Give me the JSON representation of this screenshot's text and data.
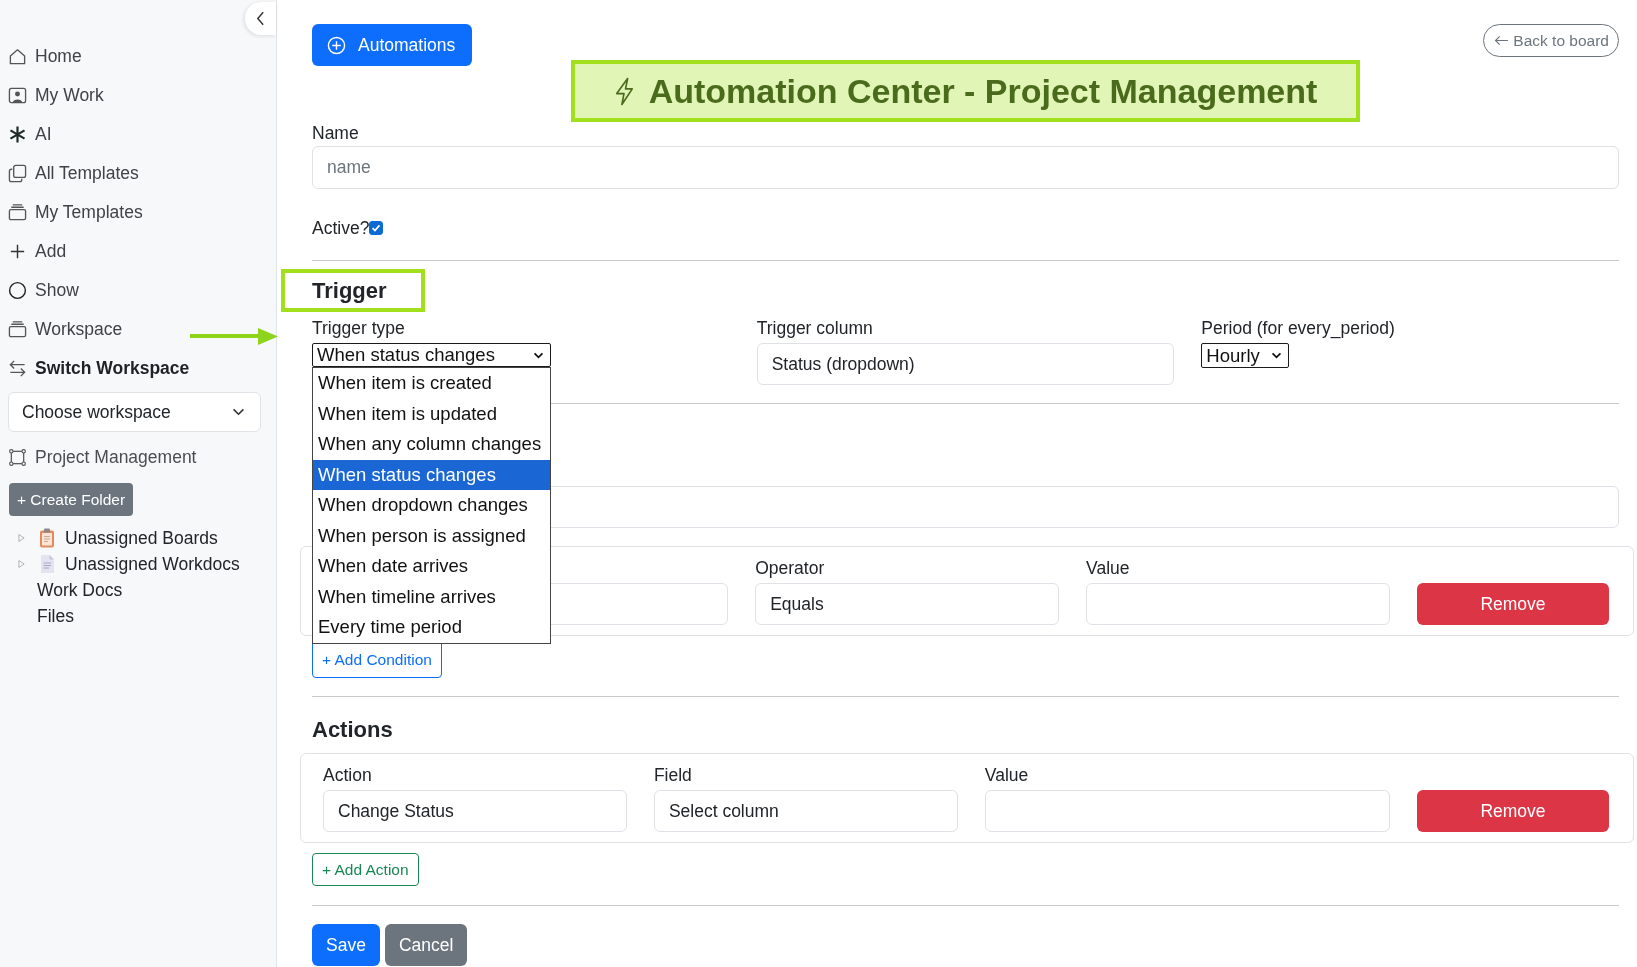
{
  "sidebar": {
    "items": [
      {
        "label": "Home",
        "kind": "link"
      },
      {
        "label": "My Work",
        "kind": "link"
      },
      {
        "label": "AI",
        "kind": "link"
      },
      {
        "label": "All Templates",
        "kind": "link"
      },
      {
        "label": "My Templates",
        "kind": "link"
      },
      {
        "label": "Add",
        "kind": "link"
      },
      {
        "label": "Show",
        "kind": "link"
      },
      {
        "label": "Workspace",
        "kind": "link"
      },
      {
        "label": "Switch Workspace",
        "kind": "heading"
      }
    ],
    "workspace_select": {
      "value": "Choose workspace"
    },
    "workspace": {
      "label": "Project Management"
    },
    "create_folder_button": "+ Create Folder",
    "tree": [
      {
        "label": "Unassigned Boards",
        "kind": "boards",
        "expanded": false
      },
      {
        "label": "Unassigned Workdocs",
        "kind": "docs",
        "expanded": false
      },
      {
        "label": "Work Docs",
        "kind": "link"
      },
      {
        "label": "Files",
        "kind": "link"
      }
    ]
  },
  "header": {
    "automations_button": "Automations",
    "title": "Automation Center - Project Management",
    "back_button": "Back to board"
  },
  "name_field": {
    "label": "Name",
    "placeholder": "name"
  },
  "active": {
    "label": "Active?",
    "checked": true
  },
  "trigger": {
    "heading": "Trigger",
    "type_select": {
      "label": "Trigger type",
      "value": "When status changes",
      "open": true,
      "options": [
        {
          "label": "When item is created",
          "selected": false
        },
        {
          "label": "When item is updated",
          "selected": false
        },
        {
          "label": "When any column changes",
          "selected": false
        },
        {
          "label": "When status changes",
          "selected": true
        },
        {
          "label": "When dropdown changes",
          "selected": false
        },
        {
          "label": "When person is assigned",
          "selected": false
        },
        {
          "label": "When date arrives",
          "selected": false
        },
        {
          "label": "When timeline arrives",
          "selected": false
        },
        {
          "label": "Every time period",
          "selected": false
        }
      ]
    },
    "column_field": {
      "label": "Trigger column",
      "value": "Status (dropdown)"
    },
    "period_select": {
      "label": "Period (for every_period)",
      "value": "Hourly"
    }
  },
  "conditions": {
    "rows": [
      {
        "fields": [
          {
            "label": "Operator",
            "value": "Equals"
          },
          {
            "label": "Value"
          }
        ],
        "remove_button": "Remove"
      }
    ],
    "add_button": "+ Add Condition"
  },
  "actions": {
    "heading": "Actions",
    "rows": [
      {
        "fields": [
          {
            "label": "Action",
            "value": "Change Status"
          },
          {
            "label": "Field",
            "value": "Select column"
          },
          {
            "label": "Value"
          }
        ],
        "remove_button": "Remove"
      }
    ],
    "add_button": "+ Add Action"
  },
  "footer": {
    "save_button": "Save",
    "cancel_button": "Cancel"
  }
}
